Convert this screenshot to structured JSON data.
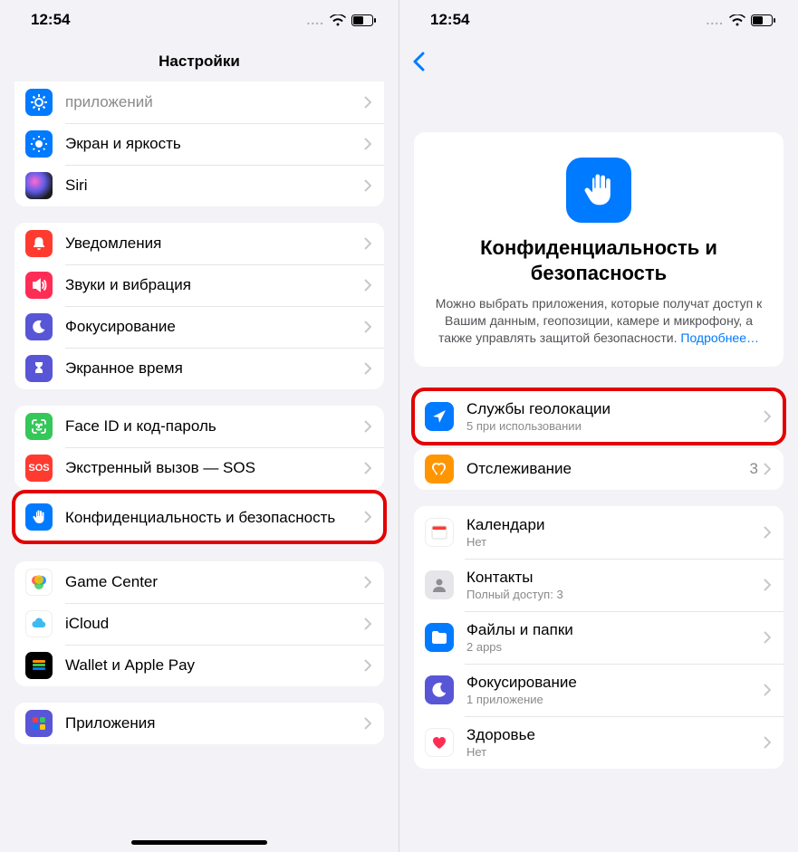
{
  "status": {
    "time": "12:54"
  },
  "left": {
    "title": "Настройки",
    "partial_row": "приложений",
    "g1": [
      {
        "label": "Экран и яркость",
        "icon": "display",
        "bg": "#007aff"
      },
      {
        "label": "Siri",
        "icon": "siri",
        "bg": "#1c1c1e"
      }
    ],
    "g2": [
      {
        "label": "Уведомления",
        "icon": "bell",
        "bg": "#ff3b30"
      },
      {
        "label": "Звуки и вибрация",
        "icon": "sound",
        "bg": "#ff2d55"
      },
      {
        "label": "Фокусирование",
        "icon": "focus",
        "bg": "#5856d6"
      },
      {
        "label": "Экранное время",
        "icon": "hourglass",
        "bg": "#5856d6"
      }
    ],
    "g3": [
      {
        "label": "Face ID и код-пароль",
        "icon": "faceid",
        "bg": "#34c759"
      },
      {
        "label": "Экстренный вызов — SOS",
        "icon": "sos",
        "bg": "#ff3b30"
      }
    ],
    "g3b": [
      {
        "label": "Конфиденциальность и безопасность",
        "icon": "hand",
        "bg": "#007aff"
      }
    ],
    "g4": [
      {
        "label": "Game Center",
        "icon": "gamecenter",
        "bg": "#ffffff"
      },
      {
        "label": "iCloud",
        "icon": "icloud",
        "bg": "#ffffff"
      },
      {
        "label": "Wallet и Apple Pay",
        "icon": "wallet",
        "bg": "#000000"
      }
    ],
    "g5": [
      {
        "label": "Приложения",
        "icon": "apps",
        "bg": "#5856d6"
      }
    ]
  },
  "right": {
    "hero": {
      "title": "Конфиденциальность и безопасность",
      "desc": "Можно выбрать приложения, которые получат доступ к Вашим данным, геопозиции, камере и микрофону, а также управлять защитой безопасности. ",
      "link": "Подробнее…"
    },
    "g1": [
      {
        "label": "Службы геолокации",
        "sub": "5 при использовании",
        "icon": "location",
        "bg": "#007aff"
      },
      {
        "label": "Отслеживание",
        "value": "3",
        "icon": "tracking",
        "bg": "#ff9500"
      }
    ],
    "g2": [
      {
        "label": "Календари",
        "sub": "Нет",
        "icon": "calendar",
        "bg": "#ffffff"
      },
      {
        "label": "Контакты",
        "sub": "Полный доступ: 3",
        "icon": "contacts",
        "bg": "#e5e5ea"
      },
      {
        "label": "Файлы и папки",
        "sub": "2 apps",
        "icon": "folder",
        "bg": "#007aff"
      },
      {
        "label": "Фокусирование",
        "sub": "1 приложение",
        "icon": "focus",
        "bg": "#5856d6"
      },
      {
        "label": "Здоровье",
        "sub": "Нет",
        "icon": "health",
        "bg": "#ffffff"
      }
    ]
  }
}
